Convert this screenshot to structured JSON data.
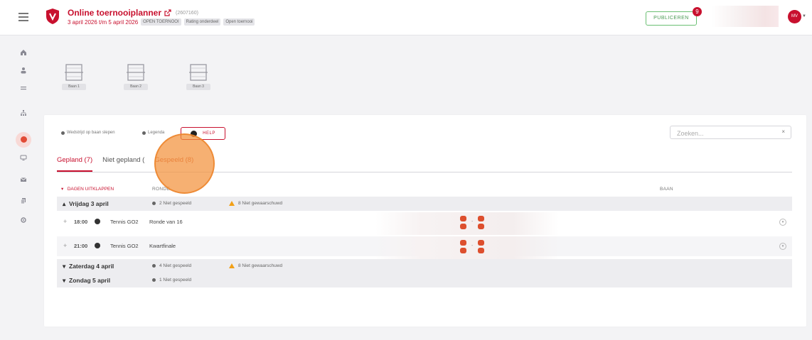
{
  "header": {
    "title": "Online toernooiplanner",
    "tournament_id": "(2607160)",
    "dates": "3 april 2026 t/m 5 april 2026",
    "tags": [
      "OPEN TOERNOOI",
      "Rating onderdeel",
      "Open toernooi"
    ],
    "publish_label": "PUBLICEREN",
    "publish_count": "9",
    "avatar_initials": "MV"
  },
  "nav": {
    "icons": [
      "home-icon",
      "users-icon",
      "list-icon",
      "hierarchy-icon",
      "schedule-icon",
      "monitor-icon",
      "mail-icon",
      "documents-icon",
      "settings-icon"
    ],
    "active": "schedule-icon"
  },
  "courts": [
    "Baan 1",
    "Baan 2",
    "Baan 3"
  ],
  "toolbar": {
    "drag_match": "Wedstrijd op baan slepen",
    "legend": "Legenda",
    "help": "HELP",
    "search_placeholder": "Zoeken...",
    "search_value": "",
    "clear": "×"
  },
  "tabs": [
    {
      "label": "Gepland (7)",
      "active": true
    },
    {
      "label": "Niet gepland (",
      "active": false
    },
    {
      "label": "Gespeeld (8)",
      "active": false
    }
  ],
  "tabs_hidden_text": ")",
  "table": {
    "expand_label": "DAGEN UITKLAPPEN",
    "col_round": "RONDE",
    "col_court": "BAAN",
    "days": [
      {
        "label": "Vrijdag 3 april",
        "not_played": "2 Niet gespeeld",
        "warned": "8 Niet gewaarschuwd"
      },
      {
        "label": "Zaterdag 4 april",
        "not_played": "4 Niet gespeeld",
        "warned": "8 Niet gewaarschuwd"
      },
      {
        "label": "Zondag 5 april",
        "not_played": "1 Niet gespeeld",
        "warned": ""
      }
    ],
    "matches": [
      {
        "time": "18:00",
        "category": "Tennis GO2",
        "round": "Ronde van 16",
        "separator": "-"
      },
      {
        "time": "21:00",
        "category": "Tennis GO2",
        "round": "Kwartfinale",
        "separator": "-"
      }
    ]
  },
  "colors": {
    "brand": "#c8102e",
    "accent_orange": "#f2923c",
    "publish_green": "#4a9a54",
    "warning": "#f2a017"
  }
}
